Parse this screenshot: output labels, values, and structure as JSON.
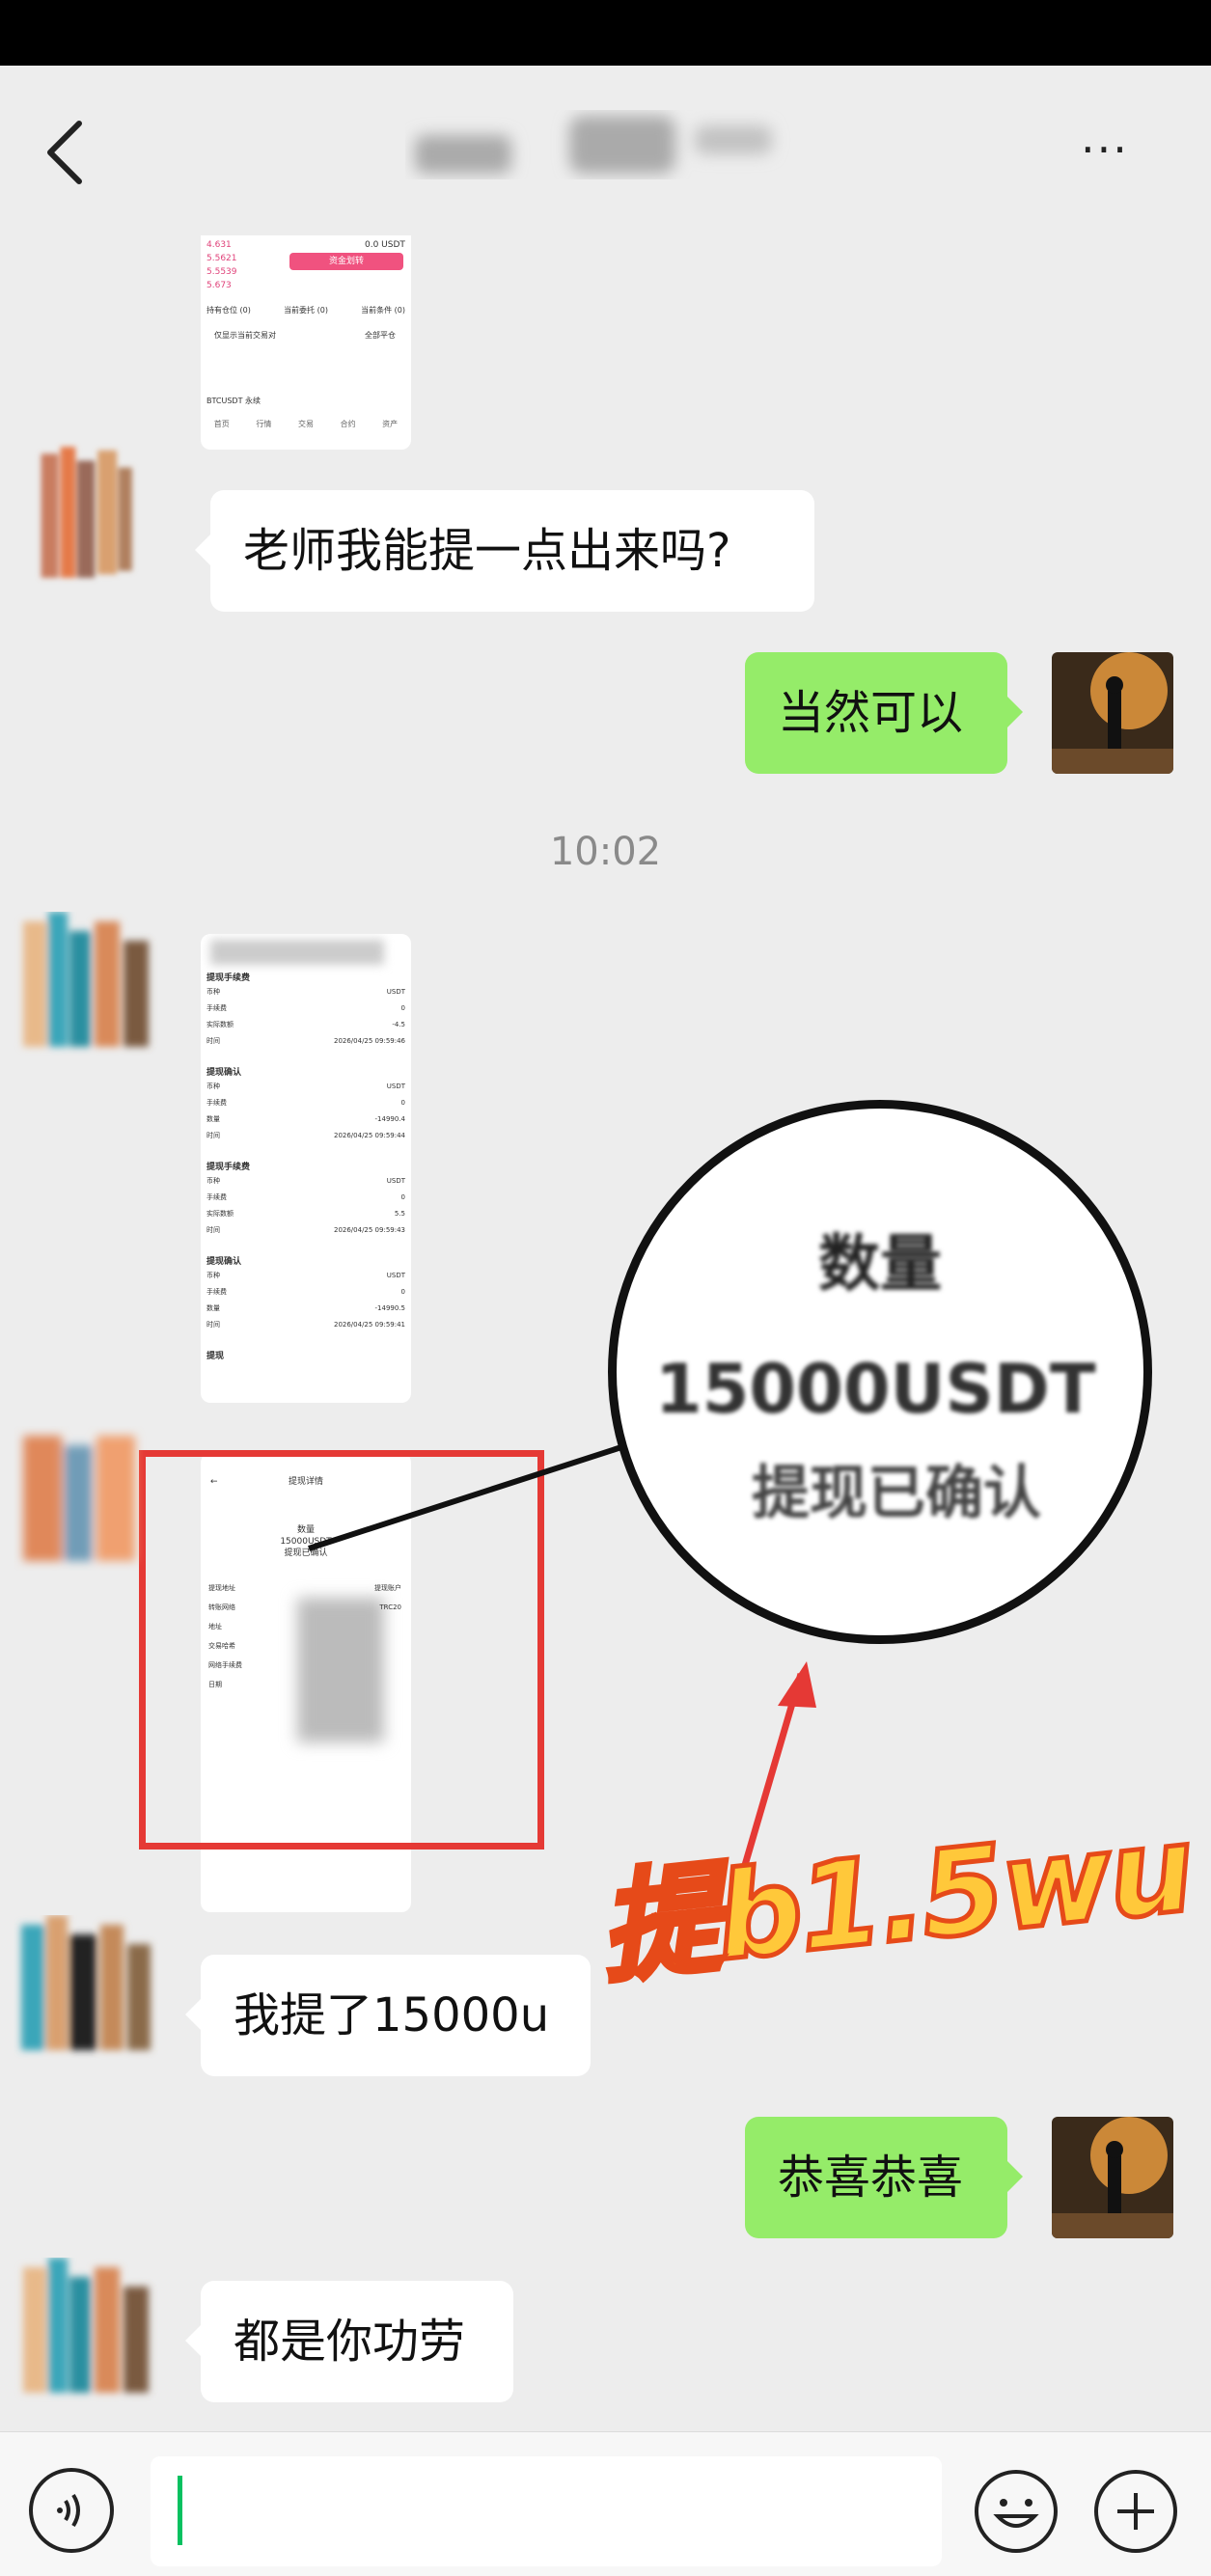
{
  "nav": {
    "back_icon": "chevron-left-icon",
    "more_label": "···"
  },
  "messages": {
    "m1": "老师我能提一点出来吗?",
    "m2": "当然可以",
    "time": "10:02",
    "m3": "我提了15000u",
    "m4": "恭喜恭喜",
    "m5": "都是你功劳"
  },
  "screenshot_top": {
    "rows": [
      {
        "price": "4.631",
        "change": "0.0 USDT"
      },
      {
        "price": "5.5621",
        "change": ""
      },
      {
        "price": "5.5539",
        "change": ""
      },
      {
        "price": "5.673",
        "change": ""
      }
    ],
    "button_label": "资金划转",
    "tabs": [
      "持有仓位 (0)",
      "当前委托 (0)",
      "当前条件 (0)"
    ],
    "hint": "仅显示当前交易对",
    "right_hint": "全部平仓",
    "pair_label": "BTCUSDT 永续",
    "bottom_nav": [
      "首页",
      "行情",
      "交易",
      "合约",
      "资产"
    ]
  },
  "screenshot_mid": {
    "sections": [
      {
        "title": "提现手续费",
        "rows": [
          [
            "币种",
            "USDT"
          ],
          [
            "手续费",
            "0"
          ],
          [
            "实际数额",
            "-4.5"
          ],
          [
            "时间",
            "2026/04/25 09:59:46"
          ]
        ]
      },
      {
        "title": "提现确认",
        "rows": [
          [
            "币种",
            "USDT"
          ],
          [
            "手续费",
            "0"
          ],
          [
            "数量",
            "-14990.4"
          ],
          [
            "时间",
            "2026/04/25 09:59:44"
          ]
        ]
      },
      {
        "title": "提现手续费",
        "rows": [
          [
            "币种",
            "USDT"
          ],
          [
            "手续费",
            "0"
          ],
          [
            "实际数额",
            "5.5"
          ],
          [
            "时间",
            "2026/04/25 09:59:43"
          ]
        ]
      },
      {
        "title": "提现确认",
        "rows": [
          [
            "币种",
            "USDT"
          ],
          [
            "手续费",
            "0"
          ],
          [
            "数量",
            "-14990.5"
          ],
          [
            "时间",
            "2026/04/25 09:59:41"
          ]
        ]
      }
    ],
    "footer": "提现"
  },
  "screenshot_detail": {
    "header": "提现详情",
    "amount_label": "数量",
    "amount": "15000USDT",
    "status": "提现已确认",
    "rows": [
      [
        "提现地址",
        "提现账户"
      ],
      [
        "转账网络",
        "TRC20"
      ],
      [
        "地址",
        ""
      ],
      [
        "交易哈希",
        ""
      ],
      [
        "网络手续费",
        ""
      ],
      [
        "日期",
        ""
      ]
    ]
  },
  "zoom": {
    "line1": "数量",
    "line2": "15000USDT",
    "line3": "提现已确认"
  },
  "annotation": "提b1.5wu",
  "colors": {
    "bg": "#ededed",
    "green_bubble": "#95ec69",
    "red_box": "#e53935",
    "annotation_fill": "#ffc83a",
    "annotation_stroke": "#e64a19"
  }
}
